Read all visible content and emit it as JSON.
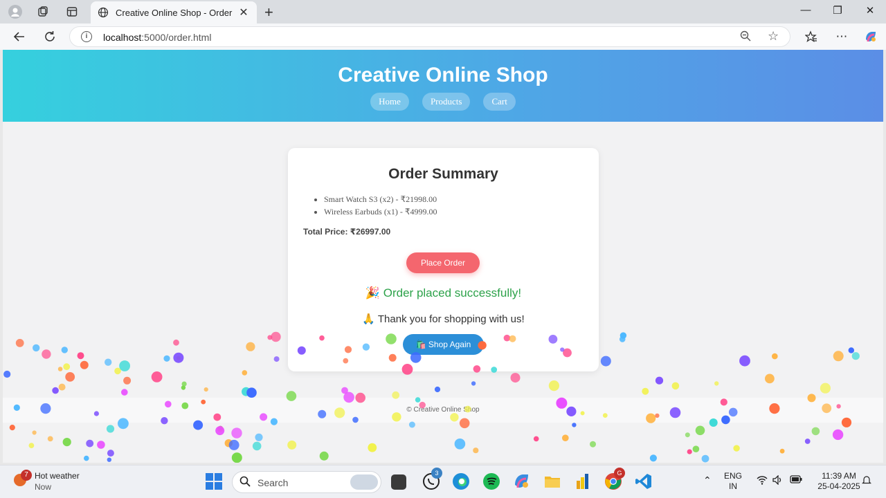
{
  "browser": {
    "tab_title": "Creative Online Shop - Order",
    "url_host": "localhost",
    "url_path": ":5000/order.html"
  },
  "site": {
    "title": "Creative Online Shop",
    "nav": [
      {
        "label": "Home"
      },
      {
        "label": "Products"
      },
      {
        "label": "Cart"
      }
    ]
  },
  "order": {
    "heading": "Order Summary",
    "items": [
      {
        "text": "Smart Watch S3 (x2) - ₹21998.00"
      },
      {
        "text": "Wireless Earbuds (x1) - ₹4999.00"
      }
    ],
    "total": "Total Price: ₹26997.00",
    "place_label": "Place Order",
    "success_msg": "🎉 Order placed successfully!",
    "thanks_msg": "🙏 Thank you for shopping with us!",
    "again_label": "🛍️ Shop Again"
  },
  "footer": {
    "text": "© Creative Online Shop"
  },
  "taskbar": {
    "weather_title": "Hot weather",
    "weather_sub": "Now",
    "weather_badge": "7",
    "search_label": "Search",
    "whatsapp_badge": "3",
    "chrome_badge": "G",
    "lang_line1": "ENG",
    "lang_line2": "IN",
    "time": "11:39 AM",
    "date": "25-04-2025"
  },
  "colors": {
    "hero_start": "#35d0de",
    "hero_end": "#5b8ee6",
    "place_button": "#f4666e",
    "shop_again_button": "#2c8fd8",
    "success_text": "#2da24a"
  },
  "icons": {
    "nav_back": "arrow-left-icon",
    "nav_reload": "reload-icon",
    "site_info": "info-icon",
    "zoom": "zoom-out-icon",
    "favorite": "star-icon"
  }
}
